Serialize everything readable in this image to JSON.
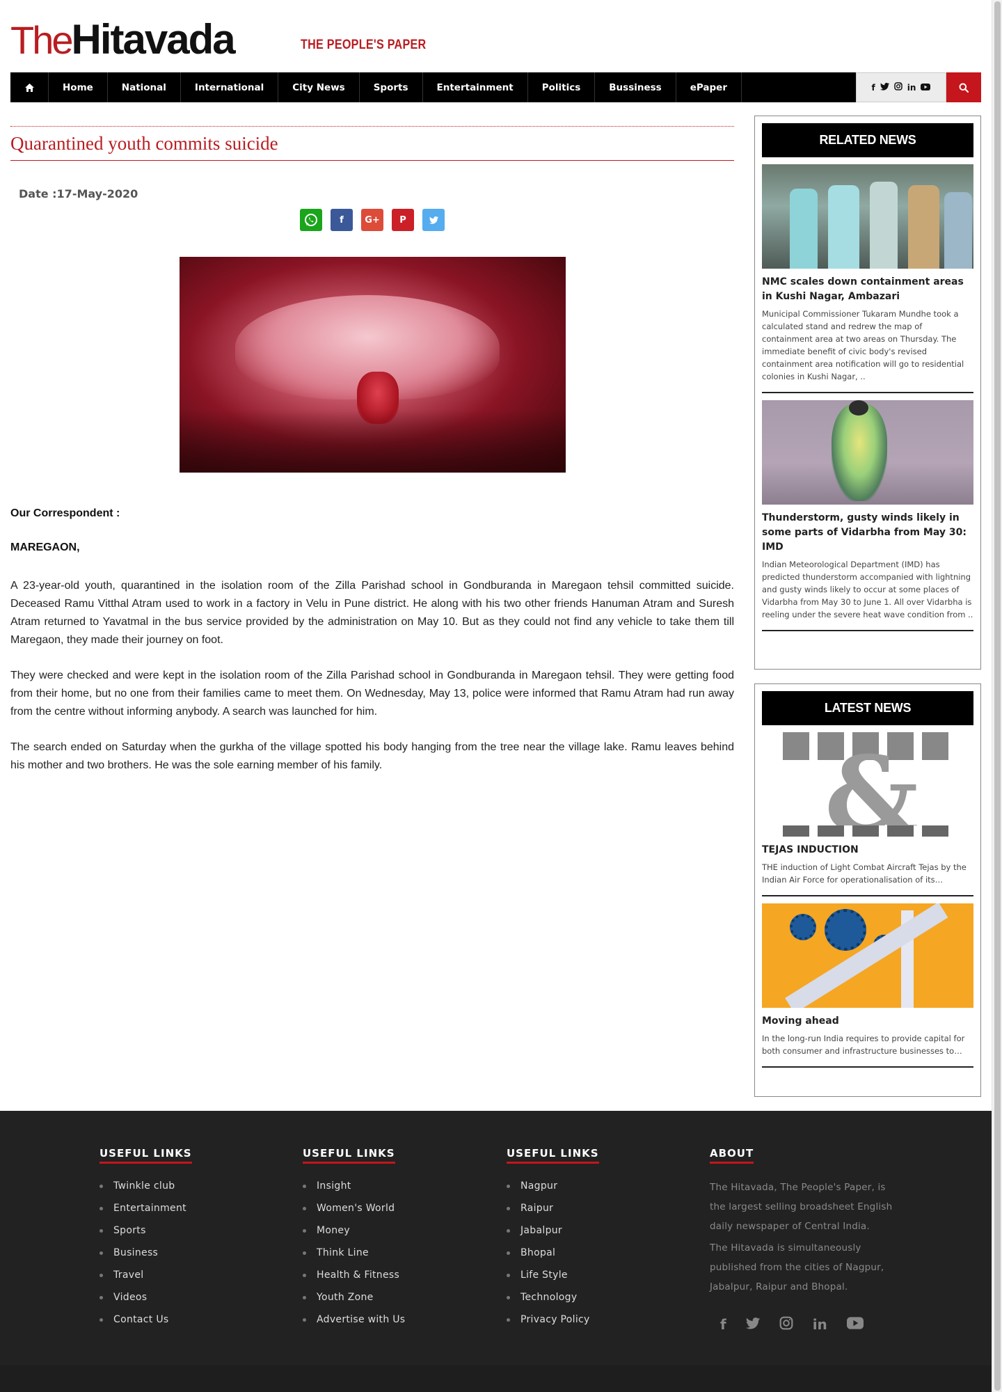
{
  "header": {
    "logo_the": "The",
    "logo_name": "Hitavada",
    "tagline": "THE PEOPLE'S PAPER"
  },
  "nav": {
    "home_icon": "home-icon",
    "items": [
      "Home",
      "National",
      "International",
      "City News",
      "Sports",
      "Entertainment",
      "Politics",
      "Bussiness",
      "ePaper"
    ],
    "social_icons": [
      "facebook-icon",
      "twitter-icon",
      "instagram-icon",
      "linkedin-icon",
      "youtube-icon"
    ],
    "search_icon": "search-icon"
  },
  "article": {
    "title": "Quarantined youth commits suicide",
    "date": "Date :17-May-2020",
    "share_icons": [
      "whatsapp-icon",
      "facebook-icon",
      "google-plus-icon",
      "pinterest-icon",
      "twitter-icon"
    ],
    "byline": "Our Correspondent :",
    "place": "MAREGAON,",
    "paragraphs": [
      "A 23-year-old youth, quarantined in the isolation room of the Zilla Parishad school in Gondburanda in Maregaon tehsil committed suicide. Deceased Ramu Vitthal Atram used to work in a factory in Velu in Pune district. He along with his two other friends Hanuman Atram and Suresh Atram returned to Yavatmal in the bus service provided by the administration on May 10. But as they could not find any vehicle to take them till Maregaon, they made their journey on foot.",
      "They were checked and were kept in the isolation room of the Zilla Parishad school in Gondburanda in Maregaon tehsil. They were getting food from their home, but no one from their families came to meet them. On Wednesday, May 13, police were informed that Ramu Atram had run away from the centre without informing anybody. A search was launched for him.",
      "The search ended on Saturday when the gurkha of the village spotted his body hanging from the tree near the village lake. Ramu leaves behind his mother and two brothers. He was the sole earning member of his family."
    ]
  },
  "sidebar": {
    "related": {
      "heading": "RELATED NEWS",
      "items": [
        {
          "title": "NMC scales down containment areas in Kushi Nagar, Ambazari",
          "excerpt": "Municipal Commissioner Tukaram Mundhe took a calculated stand and redrew the map of containment area at two areas on Thursday. The immediate benefit of civic body's revised containment area notification will go to residential colonies in Kushi Nagar, .."
        },
        {
          "title": "Thunderstorm, gusty winds likely in some parts of Vidarbha from May 30: IMD",
          "excerpt": "Indian Meteorological Department (IMD) has predicted thunderstorm accompanied with lightning and gusty winds likely to occur at some places of Vidarbha from May 30 to June 1. All over Vidarbha is reeling under the severe heat wave condition from .."
        }
      ]
    },
    "latest": {
      "heading": "LATEST NEWS",
      "items": [
        {
          "title": "TEJAS INDUCTION",
          "excerpt": "THE induction of Light Combat Aircraft Tejas by the Indian Air Force for operationalisation of its…"
        },
        {
          "title": "Moving ahead",
          "excerpt": "In the long-run India requires to provide capital for both consumer and infrastructure businesses to…"
        }
      ]
    }
  },
  "footer": {
    "col1": {
      "heading": "USEFUL LINKS",
      "links": [
        "Twinkle club",
        "Entertainment",
        "Sports",
        "Business",
        "Travel",
        "Videos",
        "Contact Us"
      ]
    },
    "col2": {
      "heading": "USEFUL LINKS",
      "links": [
        "Insight",
        "Women's World",
        "Money",
        "Think Line",
        "Health & Fitness",
        "Youth Zone",
        "Advertise with Us"
      ]
    },
    "col3": {
      "heading": "USEFUL LINKS",
      "links": [
        "Nagpur",
        "Raipur",
        "Jabalpur",
        "Bhopal",
        "Life Style",
        "Technology",
        "Privacy Policy"
      ]
    },
    "about": {
      "heading": "ABOUT",
      "text1": "The Hitavada, The People's Paper, is the largest selling broadsheet English daily newspaper of Central India.",
      "text2": "The Hitavada is simultaneously published from the cities of Nagpur, Jabalpur, Raipur and Bhopal.",
      "social_icons": [
        "facebook-icon",
        "twitter-icon",
        "instagram-icon",
        "linkedin-icon",
        "youtube-icon"
      ]
    }
  },
  "colors": {
    "brand_red": "#c4161c",
    "nav_bg": "#000000",
    "footer_bg": "#222222"
  }
}
